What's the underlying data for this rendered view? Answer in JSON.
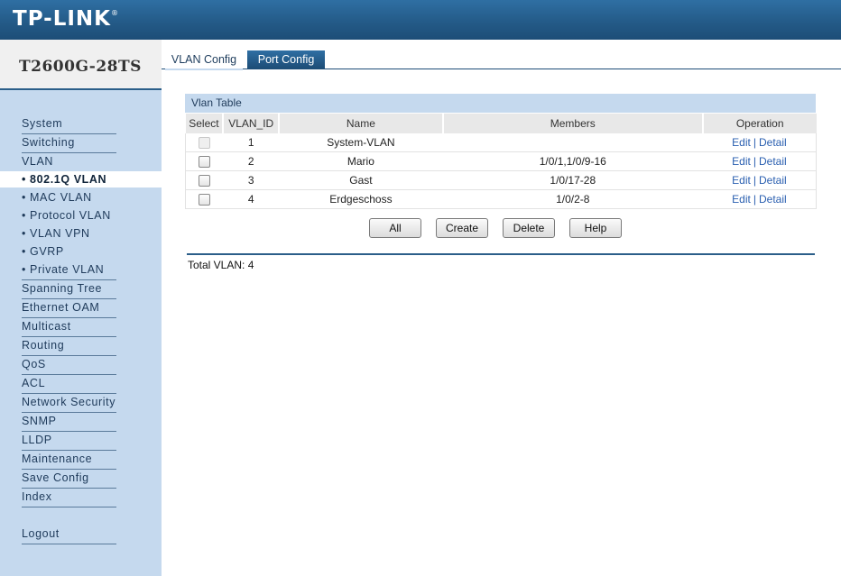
{
  "header": {
    "logo": "TP-LINK",
    "logo_mark": "®"
  },
  "model": "T2600G-28TS",
  "sidebar": {
    "items": [
      {
        "label": "System"
      },
      {
        "label": "Switching"
      },
      {
        "label": "VLAN"
      },
      {
        "label": "• 802.1Q VLAN",
        "active": true
      },
      {
        "label": "• MAC VLAN"
      },
      {
        "label": "• Protocol VLAN"
      },
      {
        "label": "• VLAN VPN"
      },
      {
        "label": "• GVRP"
      },
      {
        "label": "• Private VLAN"
      },
      {
        "label": "Spanning Tree"
      },
      {
        "label": "Ethernet OAM"
      },
      {
        "label": "Multicast"
      },
      {
        "label": "Routing"
      },
      {
        "label": "QoS"
      },
      {
        "label": "ACL"
      },
      {
        "label": "Network Security"
      },
      {
        "label": "SNMP"
      },
      {
        "label": "LLDP"
      },
      {
        "label": "Maintenance"
      },
      {
        "label": "Save Config"
      },
      {
        "label": "Index"
      },
      {
        "label": "Logout"
      }
    ]
  },
  "tabs": [
    {
      "label": "VLAN Config",
      "active": true
    },
    {
      "label": "Port Config",
      "active": false
    }
  ],
  "table": {
    "title": "Vlan Table",
    "headers": [
      "Select",
      "VLAN_ID",
      "Name",
      "Members",
      "Operation"
    ],
    "rows": [
      {
        "id": "1",
        "name": "System-VLAN",
        "members": "",
        "edit": "Edit",
        "sep": "|",
        "detail": "Detail"
      },
      {
        "id": "2",
        "name": "Mario",
        "members": "1/0/1,1/0/9-16",
        "edit": "Edit",
        "sep": "|",
        "detail": "Detail"
      },
      {
        "id": "3",
        "name": "Gast",
        "members": "1/0/17-28",
        "edit": "Edit",
        "sep": "|",
        "detail": "Detail"
      },
      {
        "id": "4",
        "name": "Erdgeschoss",
        "members": "1/0/2-8",
        "edit": "Edit",
        "sep": "|",
        "detail": "Detail"
      }
    ]
  },
  "buttons": {
    "all": "All",
    "create": "Create",
    "delete": "Delete",
    "help": "Help"
  },
  "total": "Total VLAN: 4",
  "colors": {
    "header": "#245b88",
    "sidebar": "#c5d9ee",
    "link": "#2a5fb0"
  }
}
